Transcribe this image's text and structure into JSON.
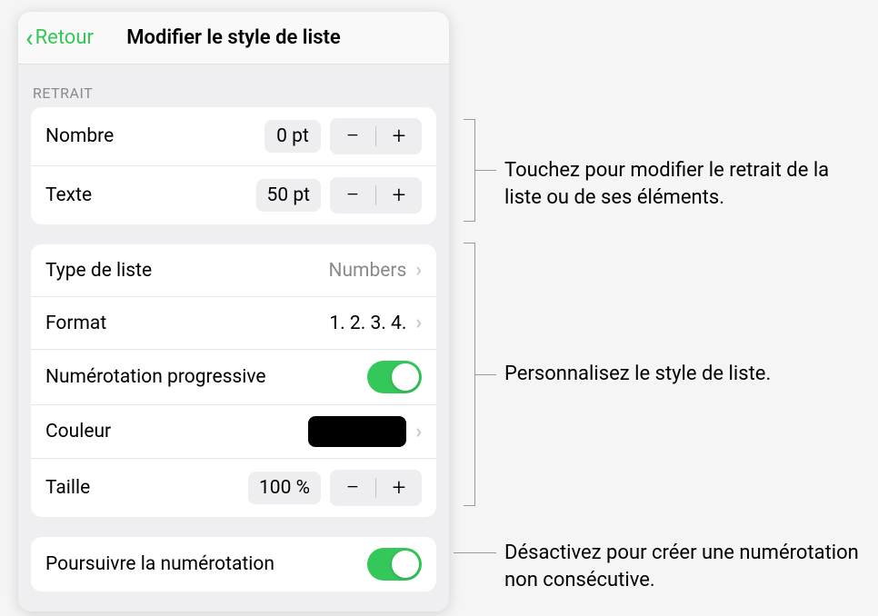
{
  "header": {
    "back_label": "Retour",
    "title": "Modifier le style de liste"
  },
  "sections": {
    "retrait_header": "RETRAIT"
  },
  "rows": {
    "nombre": {
      "label": "Nombre",
      "value": "0 pt"
    },
    "texte": {
      "label": "Texte",
      "value": "50 pt"
    },
    "type_liste": {
      "label": "Type de liste",
      "value": "Numbers"
    },
    "format": {
      "label": "Format",
      "value": "1. 2. 3. 4."
    },
    "numerotation_progressive": {
      "label": "Numérotation progressive"
    },
    "couleur": {
      "label": "Couleur"
    },
    "taille": {
      "label": "Taille",
      "value": "100 %"
    },
    "poursuivre": {
      "label": "Poursuivre la numérotation"
    }
  },
  "callouts": {
    "retrait": "Touchez pour modifier le retrait de la liste ou de ses éléments.",
    "style": "Personnalisez le style de liste.",
    "numerotation": "Désactivez pour créer une numérotation non consécutive."
  },
  "glyphs": {
    "minus": "−",
    "plus": "+"
  }
}
